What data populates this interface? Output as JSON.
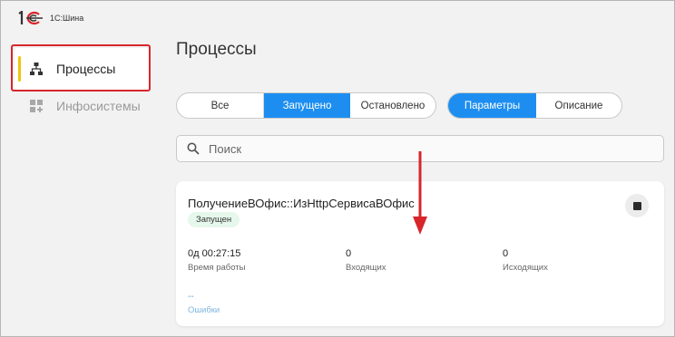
{
  "app": {
    "name": "1С:Шина",
    "logo_text": "1С"
  },
  "sidebar": {
    "items": [
      {
        "label": "Процессы",
        "icon": "hierarchy-icon",
        "active": true
      },
      {
        "label": "Инфосистемы",
        "icon": "grid-add-icon",
        "active": false
      }
    ]
  },
  "page": {
    "title": "Процессы"
  },
  "filters": {
    "state": [
      "Все",
      "Запущено",
      "Остановлено"
    ],
    "state_selected": "Запущено",
    "view": [
      "Параметры",
      "Описание"
    ],
    "view_selected": "Параметры"
  },
  "search": {
    "placeholder": "Поиск",
    "value": ""
  },
  "process": {
    "name": "ПолучениеВОфис::ИзHttpСервисаВОфис",
    "status": "Запущен",
    "uptime": {
      "value": "0д 00:27:15",
      "label": "Время работы"
    },
    "incoming": {
      "value": "0",
      "label": "Входящих"
    },
    "outgoing": {
      "value": "0",
      "label": "Исходящих"
    },
    "errors": {
      "value": "--",
      "label": "Ошибки"
    }
  },
  "colors": {
    "accent": "#1d8ef0",
    "active_marker": "#f1c40f",
    "highlight": "#d8262b",
    "status_bg": "#e6f7ec",
    "logo_red": "#d8262b"
  }
}
